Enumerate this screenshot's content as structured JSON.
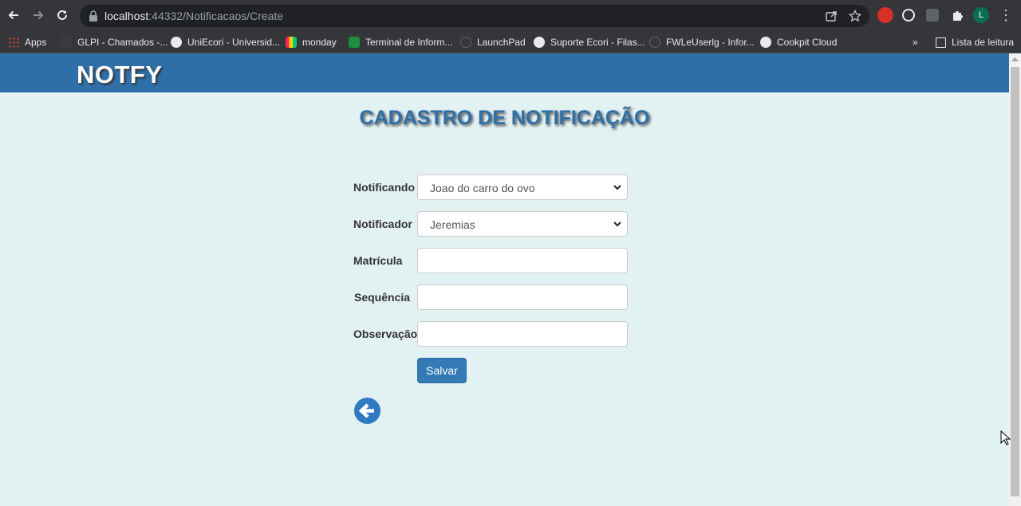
{
  "browser": {
    "url_host": "localhost",
    "url_path": ":44332/Notificacaos/Create",
    "profile_initial": "L",
    "bookmarks": [
      {
        "label": "Apps"
      },
      {
        "label": "GLPI - Chamados -..."
      },
      {
        "label": "UniEcori - Universid..."
      },
      {
        "label": "monday"
      },
      {
        "label": "Terminal de Inform..."
      },
      {
        "label": "LaunchPad"
      },
      {
        "label": "Suporte Ecori - Filas..."
      },
      {
        "label": "FWLeUserlg - Infor..."
      },
      {
        "label": "Cookpit Cloud"
      }
    ],
    "more_bookmarks": "»",
    "reading_list": "Lista de leitura"
  },
  "navbar": {
    "brand": "NOTFY"
  },
  "page": {
    "title": "CADASTRO DE NOTIFICAÇÃO"
  },
  "form": {
    "notificando_label": "Notificando",
    "notificando_value": "Joao do carro do ovo",
    "notificador_label": "Notificador",
    "notificador_value": "Jeremias",
    "matricula_label": "Matrícula",
    "matricula_value": "",
    "sequencia_label": "Sequência",
    "sequencia_value": "",
    "observacao_label": "Observação",
    "observacao_value": "",
    "save_label": "Salvar"
  },
  "colors": {
    "navbar": "#2f6fa7",
    "page_bg": "#e2f1f1",
    "primary_button": "#337ab7"
  }
}
